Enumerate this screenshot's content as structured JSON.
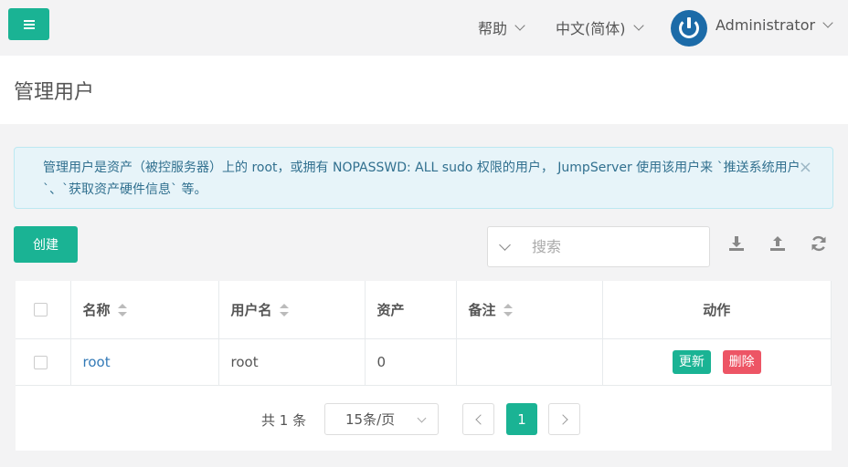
{
  "topbar": {
    "help_label": "帮助",
    "language_label": "中文(简体)",
    "user_name": "Administrator",
    "accent_color": "#1ab394"
  },
  "page": {
    "title": "管理用户"
  },
  "alert": {
    "text": "管理用户是资产（被控服务器）上的 root，或拥有 NOPASSWD: ALL sudo 权限的用户， JumpServer 使用该用户来 `推送系统用户`、`获取资产硬件信息` 等。",
    "close_symbol": "×"
  },
  "toolbar": {
    "create_label": "创建",
    "search_placeholder": "搜索",
    "icons": [
      "download-icon",
      "upload-icon",
      "refresh-icon"
    ]
  },
  "table": {
    "columns": [
      "名称",
      "用户名",
      "资产",
      "备注",
      "动作"
    ],
    "rows": [
      {
        "name": "root",
        "username": "root",
        "assets": "0",
        "comment": "",
        "update_label": "更新",
        "delete_label": "删除"
      }
    ]
  },
  "pagination": {
    "total_label": "共 1 条",
    "page_size_label": "15条/页",
    "current_page": "1"
  },
  "colors": {
    "primary": "#1ab394",
    "danger": "#ed5565",
    "link": "#337ab7",
    "alert_bg": "#e7f4f9"
  }
}
